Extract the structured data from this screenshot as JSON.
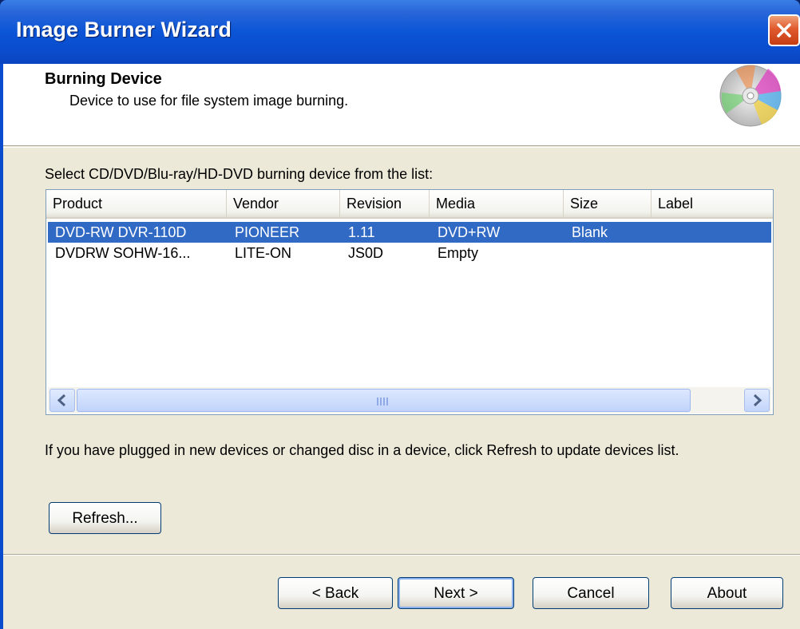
{
  "window": {
    "title": "Image Burner Wizard",
    "accent": "#0a4ccd",
    "close_icon": "close-icon"
  },
  "header": {
    "title": "Burning Device",
    "subtitle": "Device to use for file system image burning.",
    "icon": "disc-icon"
  },
  "device_list": {
    "label": "Select CD/DVD/Blu-ray/HD-DVD burning device from the list:",
    "columns": [
      "Product",
      "Vendor",
      "Revision",
      "Media",
      "Size",
      "Label"
    ],
    "rows": [
      {
        "product": "DVD-RW  DVR-110D",
        "vendor": "PIONEER",
        "revision": "1.11",
        "media": "DVD+RW",
        "size": "Blank",
        "label": "",
        "selected": true
      },
      {
        "product": "DVDRW SOHW-16...",
        "vendor": "LITE-ON",
        "revision": "JS0D",
        "media": "Empty",
        "size": "",
        "label": "",
        "selected": false
      }
    ],
    "selection_color": "#316ac5"
  },
  "info_text": "If you have plugged in new devices or changed disc in a device, click Refresh to update devices list.",
  "buttons": {
    "refresh": "Refresh...",
    "back": "< Back",
    "next": "Next >",
    "cancel": "Cancel",
    "about": "About"
  }
}
